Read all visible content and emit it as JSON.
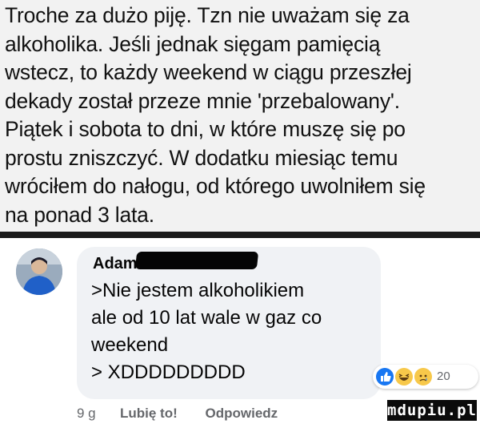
{
  "post": {
    "lines": [
      "Troche za dużo piję. Tzn nie uważam się za",
      "alkoholika. Jeśli jednak sięgam pamięcią",
      "wstecz, to każdy weekend w ciągu przeszłej",
      "dekady został przeze mnie 'przebalowany'.",
      "Piątek i sobota to dni, w które muszę się po",
      "prostu zniszczyć. W dodatku miesiąc temu",
      "wróciłem do nałogu, od którego uwolniłem się",
      "na ponad 3 lata."
    ]
  },
  "comment": {
    "author": "Adam",
    "lines": [
      ">Nie jestem alkoholikiem",
      "ale od 10 lat wale w gaz co",
      "weekend",
      "> XDDDDDDDDD"
    ],
    "reaction_count": "20",
    "reaction_icons": [
      "like-icon",
      "haha-icon",
      "sad-icon"
    ],
    "reaction_colors": {
      "like": "#1877f2",
      "emoji": "#f7c84a"
    }
  },
  "actions": {
    "time": "9 g",
    "like": "Lubię to!",
    "reply": "Odpowiedz"
  },
  "watermark": "mdupiu.pl"
}
